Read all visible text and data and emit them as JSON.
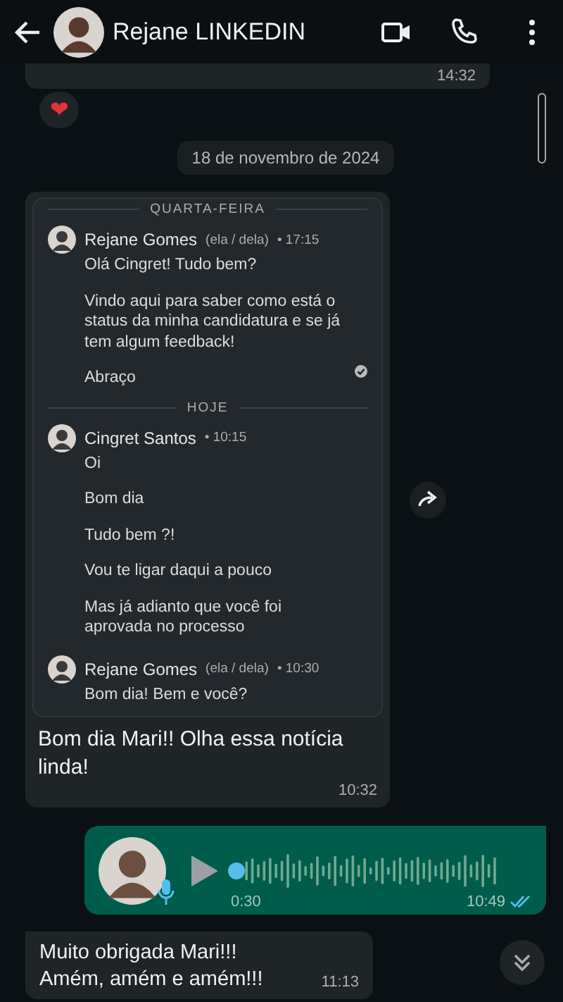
{
  "header": {
    "title": "Rejane LINKEDIN"
  },
  "top_message": {
    "time": "14:32",
    "reaction": "❤"
  },
  "date_chip": "18 de novembro de 2024",
  "shared_message": {
    "sections": [
      {
        "label": "QUARTA-FEIRA",
        "posts": [
          {
            "author": "Rejane Gomes",
            "pronouns": "(ela / dela)",
            "time": "• 17:15",
            "lines": [
              "Olá Cingret! Tudo bem?",
              "Vindo aqui para saber como está o status da minha candidatura e se já tem algum feedback!",
              "Abraço"
            ],
            "seen": true
          }
        ]
      },
      {
        "label": "HOJE",
        "posts": [
          {
            "author": "Cingret Santos",
            "time": "• 10:15",
            "lines": [
              "Oi",
              "Bom dia",
              "Tudo bem ?!",
              "Vou te ligar daqui a pouco",
              "Mas já adianto que você foi aprovada no processo"
            ],
            "seen": false
          },
          {
            "author": "Rejane Gomes",
            "pronouns": "(ela / dela)",
            "time": "• 10:30",
            "lines": [
              "Bom dia! Bem e você?"
            ],
            "seen": false
          }
        ]
      }
    ],
    "caption": "Bom dia Mari!! Olha essa notícia linda!",
    "time": "10:32"
  },
  "voice_message": {
    "duration": "0:30",
    "time": "10:49",
    "read": true
  },
  "reply": {
    "lines": [
      "Muito obrigada Mari!!!",
      "Amém, amém e amém!!!"
    ],
    "time": "11:13"
  }
}
